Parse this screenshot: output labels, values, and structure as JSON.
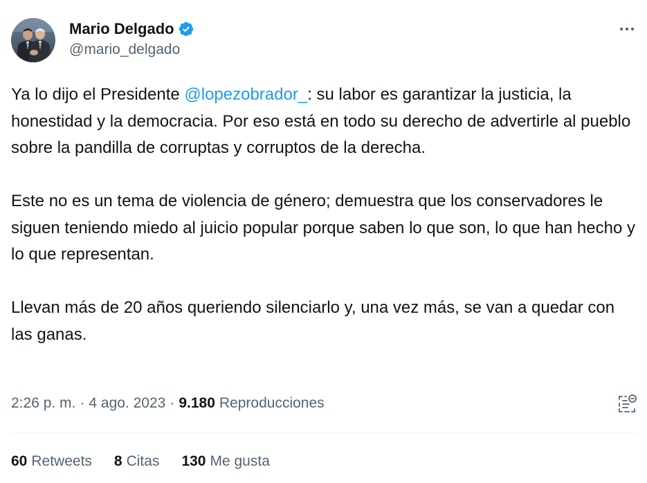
{
  "author": {
    "display_name": "Mario Delgado",
    "handle": "@mario_delgado",
    "verified_icon": "verified-badge-icon",
    "verified_color": "#1d9bf0"
  },
  "tweet": {
    "paragraph1_prefix": "Ya lo dijo el Presidente ",
    "mention": "@lopezobrador_",
    "paragraph1_suffix": ": su labor es garantizar la justicia, la honestidad y la democracia. Por eso está en todo su derecho de advertirle al pueblo sobre la pandilla de corruptas y corruptos de la derecha.",
    "paragraph2": "Este no es un tema de violencia de género; demuestra que los conservadores le siguen teniendo miedo al juicio popular porque saben lo que son, lo que han hecho y lo que representan.",
    "paragraph3": "Llevan más de 20 años queriendo silenciarlo y, una vez más, se van a quedar con las ganas."
  },
  "meta": {
    "time": "2:26 p. m.",
    "separator": "·",
    "date": "4 ago. 2023",
    "views_count": "9.180",
    "views_label": "Reproducciones"
  },
  "stats": {
    "retweets_count": "60",
    "retweets_label": "Retweets",
    "quotes_count": "8",
    "quotes_label": "Citas",
    "likes_count": "130",
    "likes_label": "Me gusta"
  },
  "colors": {
    "accent": "#1d9bf0",
    "text_primary": "#0f1419",
    "text_secondary": "#536471",
    "divider": "#eff3f4"
  },
  "icons": {
    "more": "more-horizontal-icon",
    "analytics": "view-analytics-icon"
  }
}
